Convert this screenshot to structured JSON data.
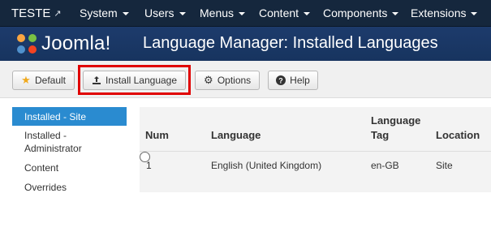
{
  "topnav": {
    "brand": "TESTE",
    "items": [
      {
        "label": "System"
      },
      {
        "label": "Users"
      },
      {
        "label": "Menus"
      },
      {
        "label": "Content"
      },
      {
        "label": "Components"
      },
      {
        "label": "Extensions"
      }
    ]
  },
  "header": {
    "logo_text": "Joomla!",
    "title": "Language Manager: Installed Languages"
  },
  "toolbar": {
    "default_label": "Default",
    "install_label": "Install Language",
    "options_label": "Options",
    "help_label": "Help"
  },
  "sidebar": {
    "items": [
      {
        "label": "Installed - Site"
      },
      {
        "label": "Installed - Administrator"
      },
      {
        "label": "Content"
      },
      {
        "label": "Overrides"
      }
    ]
  },
  "table": {
    "columns": [
      "Num",
      "Language",
      "Language Tag",
      "Location"
    ],
    "rows": [
      {
        "num": "1",
        "language": "English (United Kingdom)",
        "tag": "en-GB",
        "location": "Site"
      }
    ]
  },
  "colors": {
    "topbar": "#15273d",
    "header": "#1d3b6c",
    "active_sidebar": "#2a8bd0",
    "highlight": "#e00000",
    "default_star": "#f0a91d"
  }
}
